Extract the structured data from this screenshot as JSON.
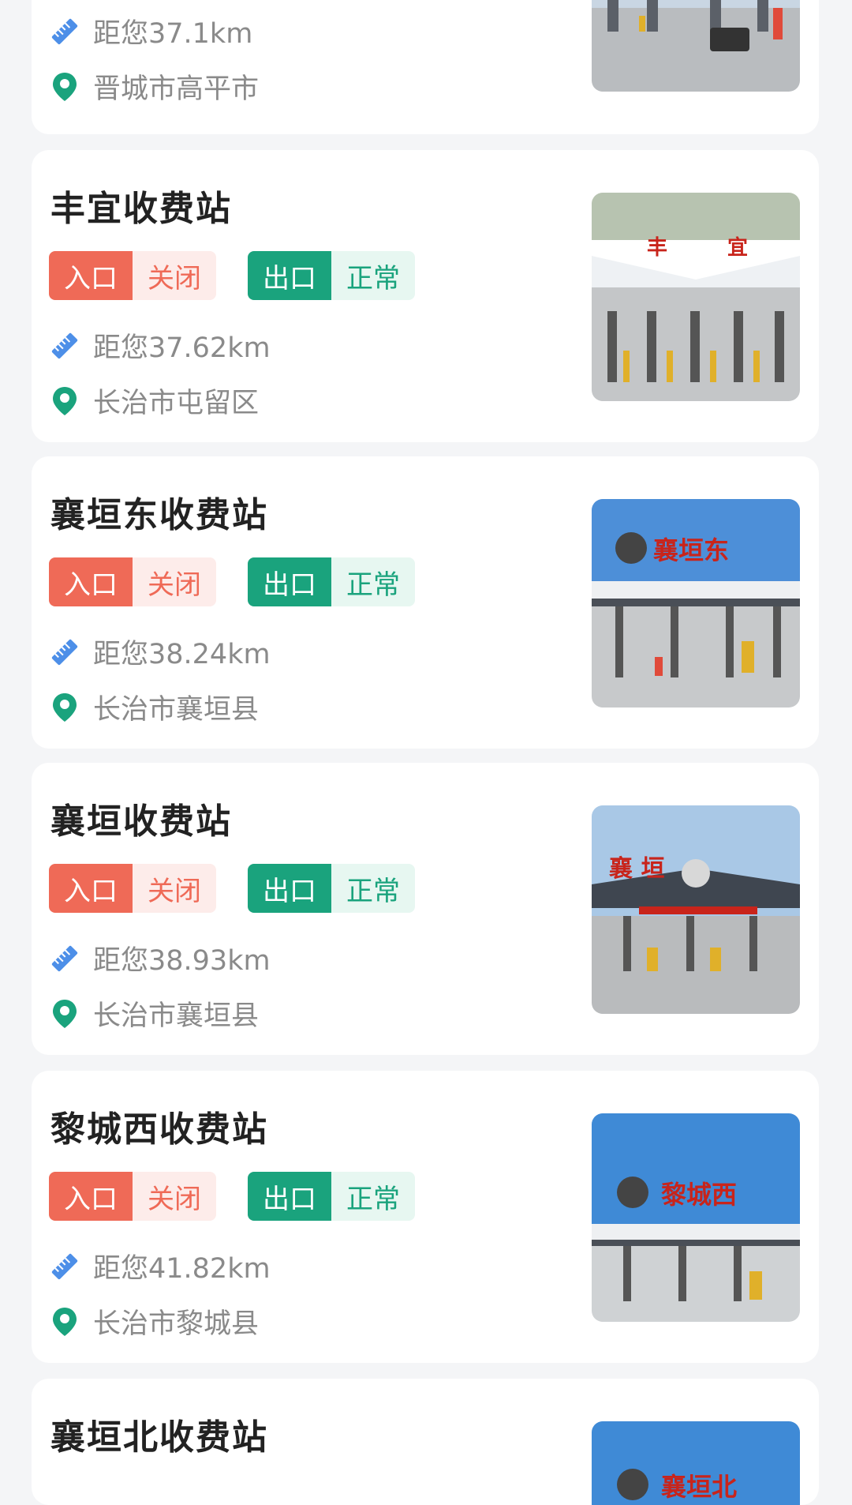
{
  "labels": {
    "entrance": "入口",
    "exit": "出口"
  },
  "icons": {
    "distance": "ruler-icon",
    "location": "location-pin-icon"
  },
  "colors": {
    "closed": "#ef6a57",
    "normal": "#1aa37d",
    "distance_icon": "#4d8fe8",
    "location_icon": "#1aa37d"
  },
  "stations": [
    {
      "distance": "距您37.1km",
      "location": "晋城市高平市"
    },
    {
      "name": "丰宜收费站",
      "entrance_status": "关闭",
      "exit_status": "正常",
      "distance": "距您37.62km",
      "location": "长治市屯留区",
      "sign_text": "丰 宜"
    },
    {
      "name": "襄垣东收费站",
      "entrance_status": "关闭",
      "exit_status": "正常",
      "distance": "距您38.24km",
      "location": "长治市襄垣县",
      "sign_text": "襄垣东"
    },
    {
      "name": "襄垣收费站",
      "entrance_status": "关闭",
      "exit_status": "正常",
      "distance": "距您38.93km",
      "location": "长治市襄垣县",
      "sign_text": "襄 垣"
    },
    {
      "name": "黎城西收费站",
      "entrance_status": "关闭",
      "exit_status": "正常",
      "distance": "距您41.82km",
      "location": "长治市黎城县",
      "sign_text": "黎城西"
    },
    {
      "name": "襄垣北收费站",
      "sign_text": "襄垣北"
    }
  ]
}
